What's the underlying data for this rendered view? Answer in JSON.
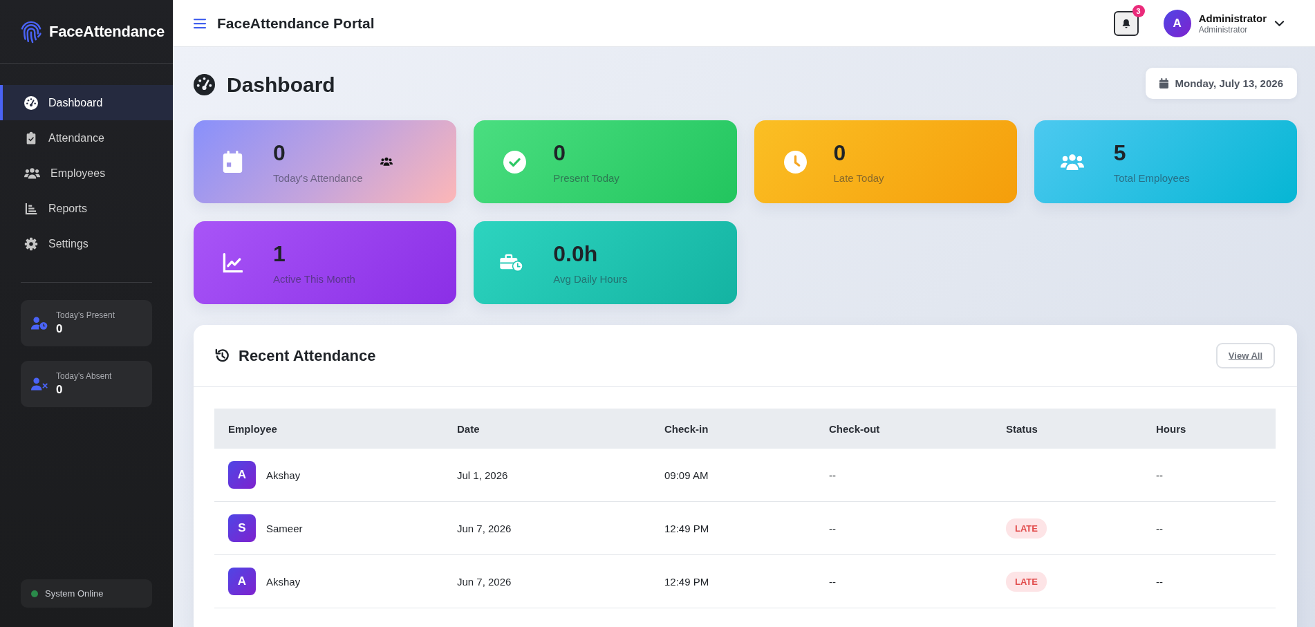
{
  "sidebar": {
    "brand": "FaceAttendance",
    "nav": [
      {
        "label": "Dashboard",
        "kind": "dashboard",
        "selected": true
      },
      {
        "label": "Attendance",
        "kind": "attendance",
        "selected": false
      },
      {
        "label": "Employees",
        "kind": "employees",
        "selected": false
      },
      {
        "label": "Reports",
        "kind": "reports",
        "selected": false
      },
      {
        "label": "Settings",
        "kind": "settings",
        "selected": false
      }
    ],
    "quick_stats": [
      {
        "kind": "present",
        "label": "Today's Present",
        "value": "0"
      },
      {
        "kind": "absent",
        "label": "Today's Absent",
        "value": "0"
      }
    ],
    "system_status": {
      "label": "System Online",
      "online": true
    }
  },
  "header": {
    "title": "FaceAttendance Portal",
    "notifications": {
      "count": "3"
    },
    "user": {
      "initial": "A",
      "name": "Administrator",
      "role": "Administrator"
    }
  },
  "page": {
    "title": "Dashboard",
    "date": "Monday, July 13, 2026"
  },
  "stat_cards": [
    {
      "kind": "attendance",
      "value": "0",
      "label": "Today's Attendance"
    },
    {
      "kind": "present",
      "value": "0",
      "label": "Present Today"
    },
    {
      "kind": "late",
      "value": "0",
      "label": "Late Today"
    },
    {
      "kind": "employees",
      "value": "5",
      "label": "Total Employees"
    },
    {
      "kind": "active",
      "value": "1",
      "label": "Active This Month"
    },
    {
      "kind": "hours",
      "value": "0.0h",
      "label": "Avg Daily Hours"
    }
  ],
  "recent_attendance": {
    "title": "Recent Attendance",
    "view_all": "View All",
    "table": {
      "columns": [
        "Employee",
        "Date",
        "Check-in",
        "Check-out",
        "Status",
        "Hours"
      ],
      "rows": [
        {
          "initial": "A",
          "employee": "Akshay",
          "date": "Jul 1, 2026",
          "check_in": "09:09 AM",
          "check_out": "--",
          "hours": "--"
        },
        {
          "initial": "S",
          "employee": "Sameer",
          "date": "Jun 7, 2026",
          "check_in": "12:49 PM",
          "check_out": "--",
          "status": {
            "kind": "late",
            "label": "LATE"
          },
          "hours": "--"
        },
        {
          "initial": "A",
          "employee": "Akshay",
          "date": "Jun 7, 2026",
          "check_in": "12:49 PM",
          "check_out": "--",
          "status": {
            "kind": "late",
            "label": "LATE"
          },
          "hours": "--"
        }
      ]
    }
  }
}
